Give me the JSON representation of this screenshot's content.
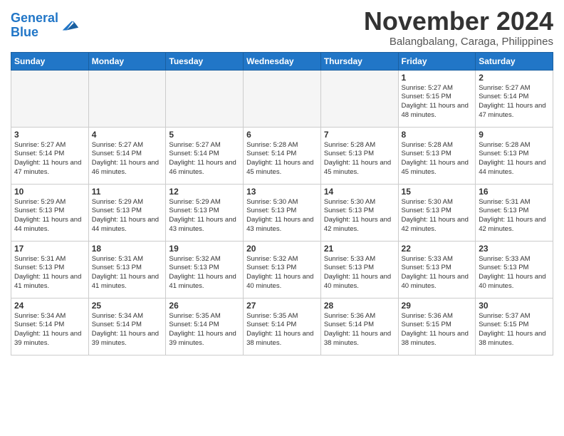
{
  "header": {
    "logo_line1": "General",
    "logo_line2": "Blue",
    "month": "November 2024",
    "location": "Balangbalang, Caraga, Philippines"
  },
  "weekdays": [
    "Sunday",
    "Monday",
    "Tuesday",
    "Wednesday",
    "Thursday",
    "Friday",
    "Saturday"
  ],
  "weeks": [
    [
      {
        "day": "",
        "info": ""
      },
      {
        "day": "",
        "info": ""
      },
      {
        "day": "",
        "info": ""
      },
      {
        "day": "",
        "info": ""
      },
      {
        "day": "",
        "info": ""
      },
      {
        "day": "1",
        "info": "Sunrise: 5:27 AM\nSunset: 5:15 PM\nDaylight: 11 hours\nand 48 minutes."
      },
      {
        "day": "2",
        "info": "Sunrise: 5:27 AM\nSunset: 5:14 PM\nDaylight: 11 hours\nand 47 minutes."
      }
    ],
    [
      {
        "day": "3",
        "info": "Sunrise: 5:27 AM\nSunset: 5:14 PM\nDaylight: 11 hours\nand 47 minutes."
      },
      {
        "day": "4",
        "info": "Sunrise: 5:27 AM\nSunset: 5:14 PM\nDaylight: 11 hours\nand 46 minutes."
      },
      {
        "day": "5",
        "info": "Sunrise: 5:27 AM\nSunset: 5:14 PM\nDaylight: 11 hours\nand 46 minutes."
      },
      {
        "day": "6",
        "info": "Sunrise: 5:28 AM\nSunset: 5:14 PM\nDaylight: 11 hours\nand 45 minutes."
      },
      {
        "day": "7",
        "info": "Sunrise: 5:28 AM\nSunset: 5:13 PM\nDaylight: 11 hours\nand 45 minutes."
      },
      {
        "day": "8",
        "info": "Sunrise: 5:28 AM\nSunset: 5:13 PM\nDaylight: 11 hours\nand 45 minutes."
      },
      {
        "day": "9",
        "info": "Sunrise: 5:28 AM\nSunset: 5:13 PM\nDaylight: 11 hours\nand 44 minutes."
      }
    ],
    [
      {
        "day": "10",
        "info": "Sunrise: 5:29 AM\nSunset: 5:13 PM\nDaylight: 11 hours\nand 44 minutes."
      },
      {
        "day": "11",
        "info": "Sunrise: 5:29 AM\nSunset: 5:13 PM\nDaylight: 11 hours\nand 44 minutes."
      },
      {
        "day": "12",
        "info": "Sunrise: 5:29 AM\nSunset: 5:13 PM\nDaylight: 11 hours\nand 43 minutes."
      },
      {
        "day": "13",
        "info": "Sunrise: 5:30 AM\nSunset: 5:13 PM\nDaylight: 11 hours\nand 43 minutes."
      },
      {
        "day": "14",
        "info": "Sunrise: 5:30 AM\nSunset: 5:13 PM\nDaylight: 11 hours\nand 42 minutes."
      },
      {
        "day": "15",
        "info": "Sunrise: 5:30 AM\nSunset: 5:13 PM\nDaylight: 11 hours\nand 42 minutes."
      },
      {
        "day": "16",
        "info": "Sunrise: 5:31 AM\nSunset: 5:13 PM\nDaylight: 11 hours\nand 42 minutes."
      }
    ],
    [
      {
        "day": "17",
        "info": "Sunrise: 5:31 AM\nSunset: 5:13 PM\nDaylight: 11 hours\nand 41 minutes."
      },
      {
        "day": "18",
        "info": "Sunrise: 5:31 AM\nSunset: 5:13 PM\nDaylight: 11 hours\nand 41 minutes."
      },
      {
        "day": "19",
        "info": "Sunrise: 5:32 AM\nSunset: 5:13 PM\nDaylight: 11 hours\nand 41 minutes."
      },
      {
        "day": "20",
        "info": "Sunrise: 5:32 AM\nSunset: 5:13 PM\nDaylight: 11 hours\nand 40 minutes."
      },
      {
        "day": "21",
        "info": "Sunrise: 5:33 AM\nSunset: 5:13 PM\nDaylight: 11 hours\nand 40 minutes."
      },
      {
        "day": "22",
        "info": "Sunrise: 5:33 AM\nSunset: 5:13 PM\nDaylight: 11 hours\nand 40 minutes."
      },
      {
        "day": "23",
        "info": "Sunrise: 5:33 AM\nSunset: 5:13 PM\nDaylight: 11 hours\nand 40 minutes."
      }
    ],
    [
      {
        "day": "24",
        "info": "Sunrise: 5:34 AM\nSunset: 5:14 PM\nDaylight: 11 hours\nand 39 minutes."
      },
      {
        "day": "25",
        "info": "Sunrise: 5:34 AM\nSunset: 5:14 PM\nDaylight: 11 hours\nand 39 minutes."
      },
      {
        "day": "26",
        "info": "Sunrise: 5:35 AM\nSunset: 5:14 PM\nDaylight: 11 hours\nand 39 minutes."
      },
      {
        "day": "27",
        "info": "Sunrise: 5:35 AM\nSunset: 5:14 PM\nDaylight: 11 hours\nand 38 minutes."
      },
      {
        "day": "28",
        "info": "Sunrise: 5:36 AM\nSunset: 5:14 PM\nDaylight: 11 hours\nand 38 minutes."
      },
      {
        "day": "29",
        "info": "Sunrise: 5:36 AM\nSunset: 5:15 PM\nDaylight: 11 hours\nand 38 minutes."
      },
      {
        "day": "30",
        "info": "Sunrise: 5:37 AM\nSunset: 5:15 PM\nDaylight: 11 hours\nand 38 minutes."
      }
    ]
  ]
}
